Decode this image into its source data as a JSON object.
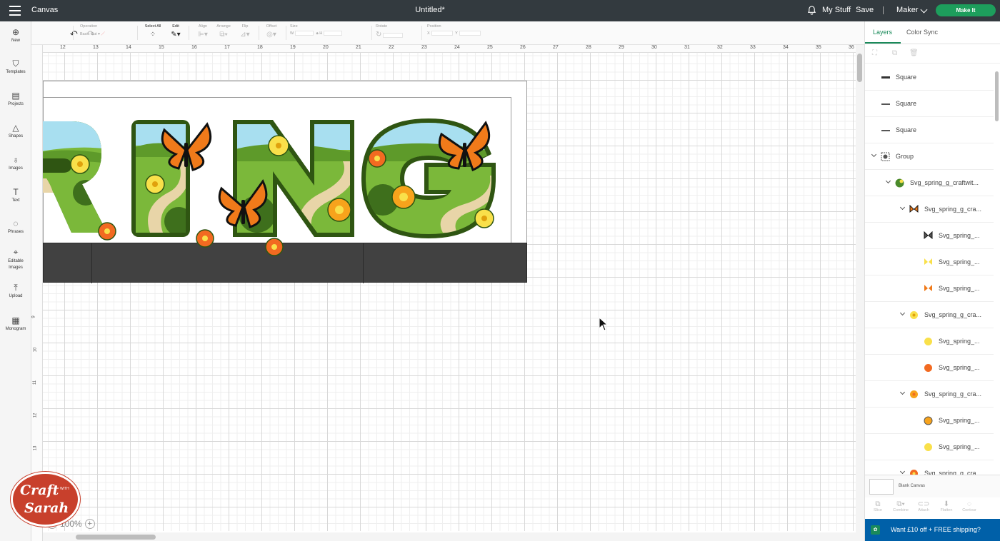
{
  "topbar": {
    "app_title": "Canvas",
    "doc_title": "Untitled*",
    "my_stuff": "My Stuff",
    "save": "Save",
    "separator": "|",
    "machine": "Maker",
    "make_it": "Make It"
  },
  "left_rail": {
    "new": "New",
    "templates": "Templates",
    "projects": "Projects",
    "shapes": "Shapes",
    "images": "Images",
    "text": "Text",
    "phrases": "Phrases",
    "editable_images": "Editable Images",
    "upload": "Upload",
    "monogram": "Monogram"
  },
  "toolbar": {
    "operation": "Operation",
    "operation_value": "Basic Cut",
    "select_all": "Select All",
    "edit": "Edit",
    "align": "Align",
    "arrange": "Arrange",
    "flip": "Flip",
    "offset": "Offset",
    "size": "Size",
    "size_w": "W",
    "size_h": "H",
    "rotate": "Rotate",
    "position": "Position",
    "pos_x": "X",
    "pos_y": "Y"
  },
  "ruler": {
    "top": [
      "12",
      "13",
      "14",
      "15",
      "16",
      "17",
      "18",
      "19",
      "20",
      "21",
      "22",
      "23",
      "24",
      "25",
      "26",
      "27",
      "28",
      "29",
      "30",
      "31",
      "32",
      "33",
      "34",
      "35",
      "36"
    ],
    "left": [
      "9",
      "10",
      "11",
      "12",
      "13"
    ]
  },
  "zoom": {
    "value": "100%",
    "minus": "−",
    "plus": "+"
  },
  "logo": {
    "line1": "Craft",
    "line2_a": "WITH",
    "line3": "Sarah"
  },
  "panel": {
    "tab_layers": "Layers",
    "tab_color_sync": "Color Sync",
    "layers": [
      {
        "label": "Square",
        "indent": 0
      },
      {
        "label": "Square",
        "indent": 0
      },
      {
        "label": "Square",
        "indent": 0
      },
      {
        "label": "Group",
        "indent": 0
      },
      {
        "label": "Svg_spring_g_craftwit...",
        "indent": 1
      },
      {
        "label": "Svg_spring_g_cra...",
        "indent": 2
      },
      {
        "label": "Svg_spring_...",
        "indent": 3
      },
      {
        "label": "Svg_spring_...",
        "indent": 3
      },
      {
        "label": "Svg_spring_...",
        "indent": 3
      },
      {
        "label": "Svg_spring_g_cra...",
        "indent": 2
      },
      {
        "label": "Svg_spring_...",
        "indent": 3
      },
      {
        "label": "Svg_spring_...",
        "indent": 3
      },
      {
        "label": "Svg_spring_g_cra...",
        "indent": 2
      },
      {
        "label": "Svg_spring_...",
        "indent": 3
      },
      {
        "label": "Svg_spring_...",
        "indent": 3
      },
      {
        "label": "Svg_spring_g_cra...",
        "indent": 2
      }
    ],
    "blank_canvas": "Blank Canvas",
    "actions": [
      "Slice",
      "Combine",
      "Attach",
      "Flatten",
      "Contour"
    ],
    "promo": "Want £10 off + FREE shipping?"
  },
  "colors": {
    "topbar": "#333a3f",
    "make_it": "#1d9e5c",
    "letter_outline": "#2f5512",
    "grass": "#7bb83a",
    "sky": "#a8dff0",
    "path": "#e8d5a8",
    "butterfly": "#f07a1a",
    "flower_yellow": "#f9e04a",
    "flower_orange": "#f26a21",
    "promo": "#0060a8"
  }
}
